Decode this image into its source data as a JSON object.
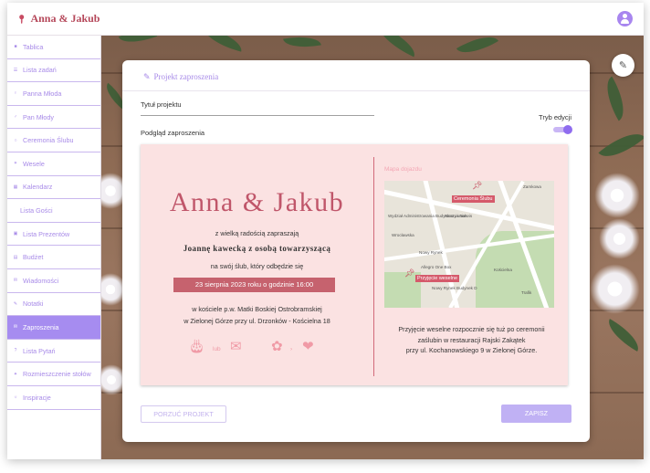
{
  "app": {
    "brand": "Anna & Jakub",
    "brand_icon": "pin-icon",
    "avatar_icon": "user-icon"
  },
  "sidebar": {
    "items": [
      {
        "label": "Tablica",
        "icon": "dashboard-icon"
      },
      {
        "label": "Lista zadań",
        "icon": "list-icon"
      },
      {
        "label": "Panna Młoda",
        "icon": "bride-icon"
      },
      {
        "label": "Pan Młody",
        "icon": "groom-icon"
      },
      {
        "label": "Ceremonia Ślubu",
        "icon": "rings-icon"
      },
      {
        "label": "Wesele",
        "icon": "glasses-icon"
      },
      {
        "label": "Kalendarz",
        "icon": "calendar-icon"
      },
      {
        "label": "Lista Gości",
        "icon": ""
      },
      {
        "label": "Lista Prezentów",
        "icon": "gift-icon"
      },
      {
        "label": "Budżet",
        "icon": "wallet-icon"
      },
      {
        "label": "Wiadomości",
        "icon": "mail-icon"
      },
      {
        "label": "Notatki",
        "icon": "pen-icon"
      },
      {
        "label": "Zaproszenia",
        "icon": "envelope-icon"
      },
      {
        "label": "Lista Pytań",
        "icon": "question-icon"
      },
      {
        "label": "Rozmieszczenie stołów",
        "icon": "table-icon"
      },
      {
        "label": "Inspiracje",
        "icon": "bulb-icon"
      }
    ],
    "active_index": 12
  },
  "card": {
    "title": "Projekt zaproszenia",
    "project_title_label": "Tytuł projektu",
    "project_title_value": "",
    "preview_label": "Podgląd zaproszenia",
    "edit_mode_label": "Tryb edycji",
    "edit_mode_on": true
  },
  "invitation": {
    "couple": "Anna & Jakub",
    "invite_text": "z wielką radością zapraszają",
    "guests": "Joannę kawecką z osobą towarzyszącą",
    "to_text": "na swój ślub, który odbędzie się",
    "date_text": "23 sierpnia 2023 roku o godzinie 16:00",
    "church_line1": "w kościele p.w. Matki Boskiej Ostrobramskiej",
    "church_line2": "w Zielonej Górze przy ul. Drzonków - Kościelna 18",
    "icons_joiner_1": "lub",
    "icons_joiner_2": "›",
    "map_label": "Mapa dojazdu",
    "map_labels": {
      "ceremony": "Ceremonia Ślubu",
      "reception": "Przyjęcie weselne",
      "place1": "Nowy Rynek",
      "place2": "Allegro One Box",
      "place3": "Nowy Rynek Budynek D",
      "place4": "Wydział Administrowania Budynkami i Serwis",
      "place5": "Warzywniak",
      "place6": "Wrocławska",
      "place7": "Kościelna",
      "place8": "Zamkowa",
      "place9": "Trafik"
    },
    "reception_line1": "Przyjęcie weselne rozpocznie się tuż po ceremonii",
    "reception_line2": "zaślubin w restauracji Rajski Zakątek",
    "reception_line3": "przy ul. Kochanowskiego 9 w Zielonej Górze."
  },
  "actions": {
    "discard": "PORZUĆ PROJEKT",
    "save": "ZAPISZ"
  }
}
